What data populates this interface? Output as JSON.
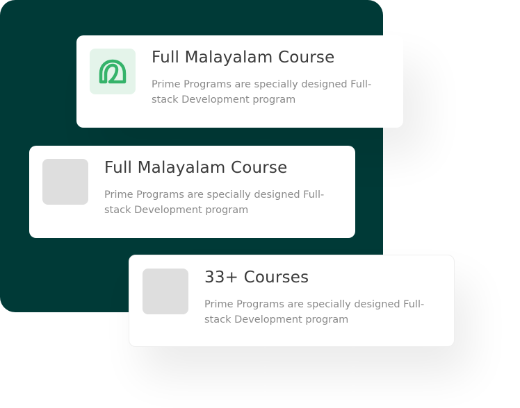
{
  "colors": {
    "backdrop": "#003a37",
    "brand_green": "#35b36a",
    "logo_tile_bg": "#e4f4ea",
    "placeholder": "#dedede"
  },
  "cards": [
    {
      "icon": "brand-logo-icon",
      "title": "Full Malayalam Course",
      "description": "Prime Programs are specially designed Full-stack Development program"
    },
    {
      "icon": "image-placeholder",
      "title": "Full Malayalam Course",
      "description": "Prime Programs are specially designed Full-stack Development program"
    },
    {
      "icon": "image-placeholder",
      "title": "33+ Courses",
      "description": "Prime Programs are specially designed Full-stack Development program"
    }
  ]
}
